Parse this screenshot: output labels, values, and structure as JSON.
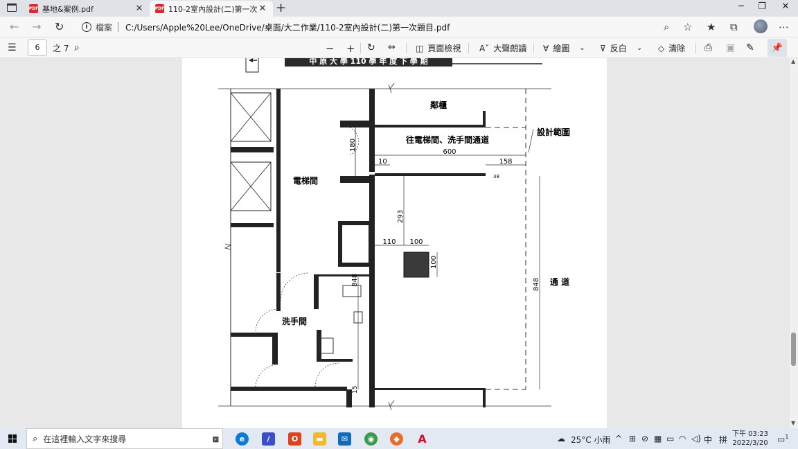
{
  "tabs": [
    {
      "title": "基地&案例.pdf",
      "active": false
    },
    {
      "title": "110-2室內設計(二)第一次題目.pdf",
      "active": true
    }
  ],
  "address": {
    "label": "檔案",
    "url": "C:/Users/Apple%20Lee/OneDrive/桌面/大二作業/110-2室內設計(二)第一次題目.pdf"
  },
  "pdf_toolbar": {
    "page_current": "6",
    "page_total": "之 7",
    "page_view": "頁面檢視",
    "read_aloud": "大聲朗讀",
    "draw": "繪圖",
    "highlight": "反白",
    "erase": "清除"
  },
  "drawing": {
    "header_banner": "中 原 大 學 110 學 年 度 下 學 期",
    "labels": {
      "neighbor": "鄰櫃",
      "corridor_to": "往電梯間、洗手間通道",
      "design_scope": "設計範圍",
      "elevator_hall": "電梯間",
      "restroom": "洗手間",
      "aisle": "通 道"
    },
    "dimensions": {
      "d600": "600",
      "d10": "10",
      "d158": "158",
      "d180": "180",
      "d293": "293",
      "d110": "110",
      "d100a": "100",
      "d100b": "100",
      "d848a": "848",
      "d848b": "848",
      "d15": "15",
      "d38": "38"
    }
  },
  "taskbar": {
    "search_placeholder": "在這裡輸入文字來搜尋",
    "weather": "25°C 小雨",
    "ime": "中",
    "ime2": "拼",
    "time": "下午 03:23",
    "date": "2022/3/20",
    "notifications": "1"
  }
}
